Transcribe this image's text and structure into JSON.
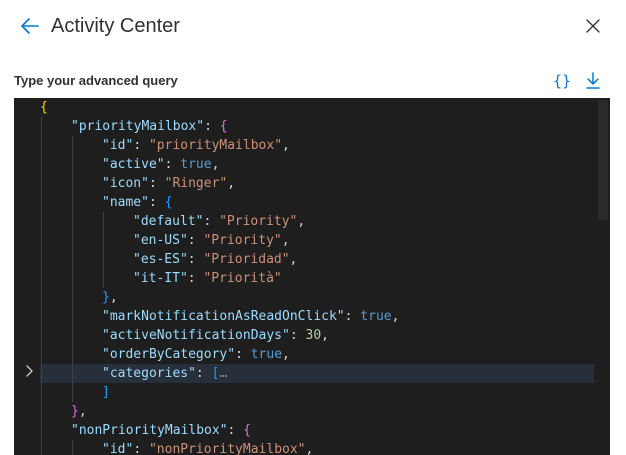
{
  "header": {
    "title": "Activity Center"
  },
  "query": {
    "label": "Type your advanced query",
    "format_glyph": "{}"
  },
  "editor": {
    "lines": [
      {
        "indent": 0,
        "tokens": [
          {
            "t": "{",
            "c": "br1"
          }
        ]
      },
      {
        "indent": 1,
        "tokens": [
          {
            "t": "\"priorityMailbox\"",
            "c": "k"
          },
          {
            "t": ": ",
            "c": "p"
          },
          {
            "t": "{",
            "c": "br2"
          }
        ]
      },
      {
        "indent": 2,
        "tokens": [
          {
            "t": "\"id\"",
            "c": "k"
          },
          {
            "t": ": ",
            "c": "p"
          },
          {
            "t": "\"priorityMailbox\"",
            "c": "s"
          },
          {
            "t": ",",
            "c": "p"
          }
        ]
      },
      {
        "indent": 2,
        "tokens": [
          {
            "t": "\"active\"",
            "c": "k"
          },
          {
            "t": ": ",
            "c": "p"
          },
          {
            "t": "true",
            "c": "b"
          },
          {
            "t": ",",
            "c": "p"
          }
        ]
      },
      {
        "indent": 2,
        "tokens": [
          {
            "t": "\"icon\"",
            "c": "k"
          },
          {
            "t": ": ",
            "c": "p"
          },
          {
            "t": "\"Ringer\"",
            "c": "s"
          },
          {
            "t": ",",
            "c": "p"
          }
        ]
      },
      {
        "indent": 2,
        "tokens": [
          {
            "t": "\"name\"",
            "c": "k"
          },
          {
            "t": ": ",
            "c": "p"
          },
          {
            "t": "{",
            "c": "br3"
          }
        ]
      },
      {
        "indent": 3,
        "tokens": [
          {
            "t": "\"default\"",
            "c": "k"
          },
          {
            "t": ": ",
            "c": "p"
          },
          {
            "t": "\"Priority\"",
            "c": "s"
          },
          {
            "t": ",",
            "c": "p"
          }
        ]
      },
      {
        "indent": 3,
        "tokens": [
          {
            "t": "\"en-US\"",
            "c": "k"
          },
          {
            "t": ": ",
            "c": "p"
          },
          {
            "t": "\"Priority\"",
            "c": "s"
          },
          {
            "t": ",",
            "c": "p"
          }
        ]
      },
      {
        "indent": 3,
        "tokens": [
          {
            "t": "\"es-ES\"",
            "c": "k"
          },
          {
            "t": ": ",
            "c": "p"
          },
          {
            "t": "\"Prioridad\"",
            "c": "s"
          },
          {
            "t": ",",
            "c": "p"
          }
        ]
      },
      {
        "indent": 3,
        "tokens": [
          {
            "t": "\"it-IT\"",
            "c": "k"
          },
          {
            "t": ": ",
            "c": "p"
          },
          {
            "t": "\"Priorità\"",
            "c": "s"
          }
        ]
      },
      {
        "indent": 2,
        "tokens": [
          {
            "t": "}",
            "c": "br3"
          },
          {
            "t": ",",
            "c": "p"
          }
        ]
      },
      {
        "indent": 2,
        "tokens": [
          {
            "t": "\"markNotificationAsReadOnClick\"",
            "c": "k"
          },
          {
            "t": ": ",
            "c": "p"
          },
          {
            "t": "true",
            "c": "b"
          },
          {
            "t": ",",
            "c": "p"
          }
        ]
      },
      {
        "indent": 2,
        "tokens": [
          {
            "t": "\"activeNotificationDays\"",
            "c": "k"
          },
          {
            "t": ": ",
            "c": "p"
          },
          {
            "t": "30",
            "c": "n"
          },
          {
            "t": ",",
            "c": "p"
          }
        ]
      },
      {
        "indent": 2,
        "tokens": [
          {
            "t": "\"orderByCategory\"",
            "c": "k"
          },
          {
            "t": ": ",
            "c": "p"
          },
          {
            "t": "true",
            "c": "b"
          },
          {
            "t": ",",
            "c": "p"
          }
        ]
      },
      {
        "indent": 2,
        "active": true,
        "tokens": [
          {
            "t": "\"categories\"",
            "c": "k"
          },
          {
            "t": ": ",
            "c": "p"
          },
          {
            "t": "[",
            "c": "br3"
          },
          {
            "t": "…",
            "c": "fold"
          }
        ]
      },
      {
        "indent": 2,
        "tokens": [
          {
            "t": "]",
            "c": "br3"
          }
        ]
      },
      {
        "indent": 1,
        "tokens": [
          {
            "t": "}",
            "c": "br2"
          },
          {
            "t": ",",
            "c": "p"
          }
        ]
      },
      {
        "indent": 1,
        "tokens": [
          {
            "t": "\"nonPriorityMailbox\"",
            "c": "k"
          },
          {
            "t": ": ",
            "c": "p"
          },
          {
            "t": "{",
            "c": "br2"
          }
        ]
      },
      {
        "indent": 2,
        "tokens": [
          {
            "t": "\"id\"",
            "c": "k"
          },
          {
            "t": ": ",
            "c": "p"
          },
          {
            "t": "\"nonPriorityMailbox\"",
            "c": "s"
          },
          {
            "t": ",",
            "c": "p"
          }
        ]
      }
    ]
  },
  "colors": {
    "accent": "#0078d4",
    "editor_bg": "#1e1e1e",
    "title_text": "#323130"
  },
  "icons": {
    "back": "arrow-left-icon",
    "close": "close-icon",
    "format": "curly-braces-icon",
    "download": "download-icon",
    "fold": "chevron-right-icon"
  }
}
